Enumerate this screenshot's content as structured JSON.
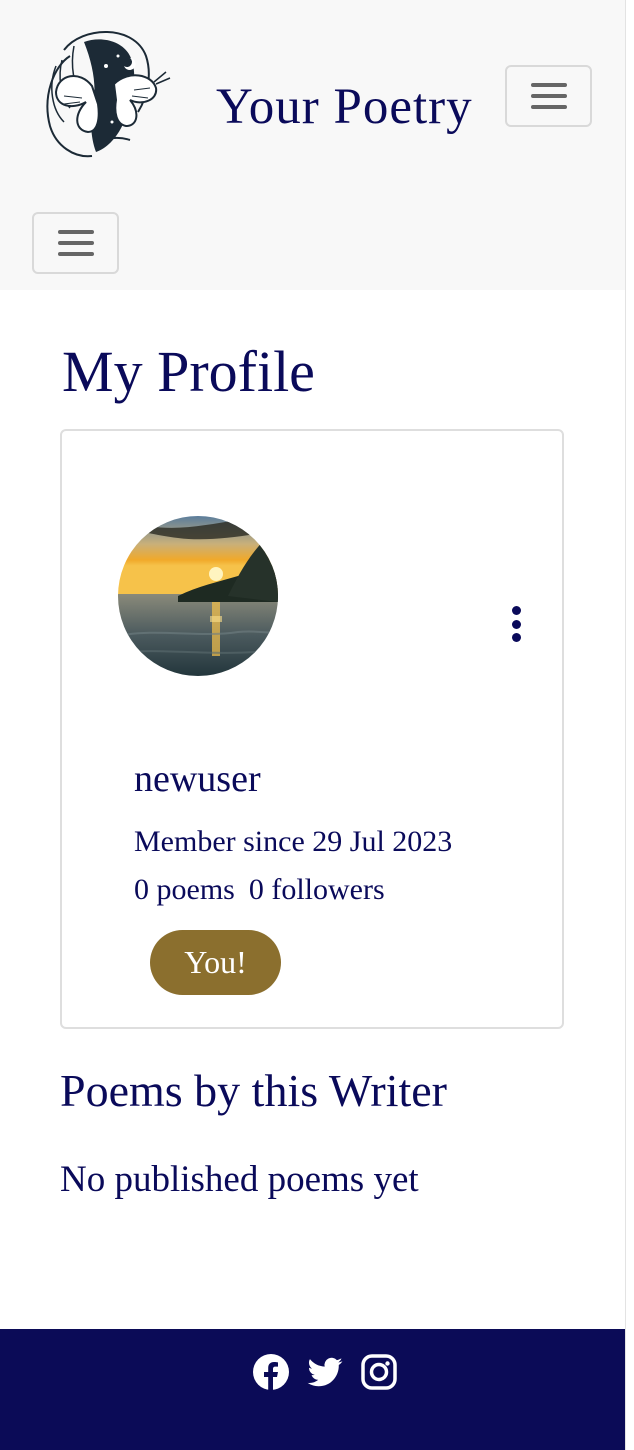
{
  "navbar": {
    "brand": "Your Poetry",
    "logo_icon": "butterfly-woman-logo",
    "toggler_icon": "hamburger-icon"
  },
  "page": {
    "title": "My Profile"
  },
  "profile": {
    "avatar_icon": "sunset-lake-avatar",
    "menu_icon": "vertical-ellipsis-icon",
    "username": "newuser",
    "member_since": "Member since 29 Jul 2023",
    "poems_count": "0 poems",
    "followers_count": "0 followers",
    "badge": "You!"
  },
  "poems_section": {
    "title": "Poems by this Writer",
    "empty_message": "No published poems yet"
  },
  "footer": {
    "social": [
      "facebook-icon",
      "twitter-icon",
      "instagram-icon"
    ]
  },
  "colors": {
    "primary": "#0a0a5a",
    "accent": "#8b6f2e",
    "navbar_bg": "#f8f8f8",
    "footer_bg": "#0b0b57"
  }
}
